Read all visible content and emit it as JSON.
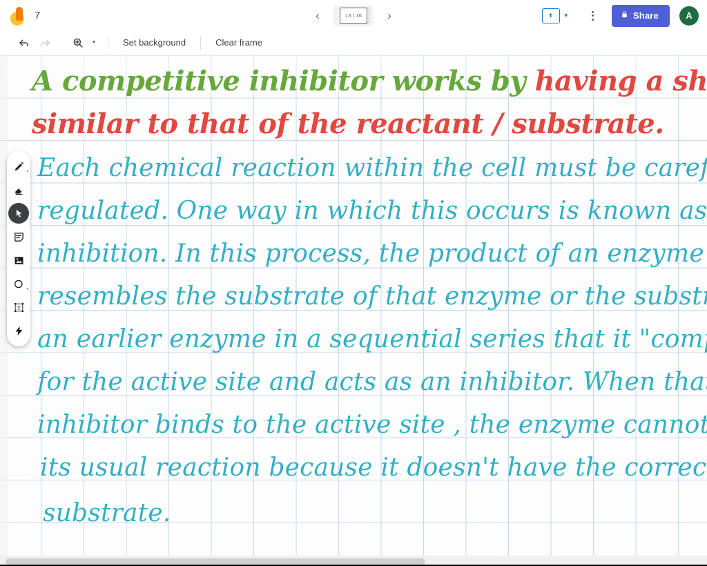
{
  "app": {
    "logo_icon": "jamboard-logo-icon",
    "title": "7"
  },
  "topbar": {
    "prev_frame_icon": "chevron-left-icon",
    "next_frame_icon": "chevron-right-icon",
    "frame_counter": "13 / 16",
    "present_icon": "present-screen-icon",
    "present_caret_icon": "chevron-down-icon",
    "more_icon": "kebab-menu-icon",
    "share_lock_icon": "lock-icon",
    "share_label": "Share",
    "avatar_initial": "A",
    "accent_blue": "#1a73e8",
    "share_blue": "#4e60d4",
    "avatar_green": "#1e6b45"
  },
  "subbar": {
    "undo_icon": "undo-icon",
    "redo_icon": "redo-icon",
    "zoom_icon": "zoom-magnifier-icon",
    "zoom_caret_icon": "chevron-down-icon",
    "set_background_label": "Set background",
    "clear_frame_label": "Clear frame"
  },
  "tools": [
    {
      "name": "pen-tool",
      "icon": "pen-icon",
      "active": false
    },
    {
      "name": "eraser-tool",
      "icon": "eraser-icon",
      "active": false
    },
    {
      "name": "select-tool",
      "icon": "cursor-arrow-icon",
      "active": true
    },
    {
      "name": "sticky-note-tool",
      "icon": "sticky-note-icon",
      "active": false
    },
    {
      "name": "image-tool",
      "icon": "image-icon",
      "active": false
    },
    {
      "name": "shape-tool",
      "icon": "circle-shape-icon",
      "active": false
    },
    {
      "name": "text-box-tool",
      "icon": "text-box-icon",
      "active": false
    },
    {
      "name": "laser-pointer-tool",
      "icon": "laser-pointer-icon",
      "active": false
    }
  ],
  "canvas": {
    "background": "graph-paper-grid",
    "grid_color": "#c8d8ef",
    "heading": {
      "color_green": "#66a83c",
      "color_red": "#e04840",
      "line1_green": "A competitive inhibitor works by",
      "line1_red": "having a shape",
      "line2_red": "similar to that of the reactant / substrate."
    },
    "body": {
      "color": "#33afc4",
      "lines": [
        "Each chemical reaction within the cell must be carefully",
        "regulated. One way in which this occurs is known as competitive",
        "inhibition. In this process, the product of an enzyme so closely",
        "resembles the substrate of that enzyme or the substrate of",
        "an earlier enzyme in a sequential series that it \"competes\"",
        "for the active site and acts as an inhibitor. When that",
        "inhibitor binds to the active site , the enzyme cannot catalyze",
        "its usual reaction because it doesn't have the correct",
        "substrate."
      ]
    }
  },
  "scrollbars": {
    "horizontal_name": "horizontal-scrollbar",
    "vertical_name": "vertical-scrollbar"
  }
}
